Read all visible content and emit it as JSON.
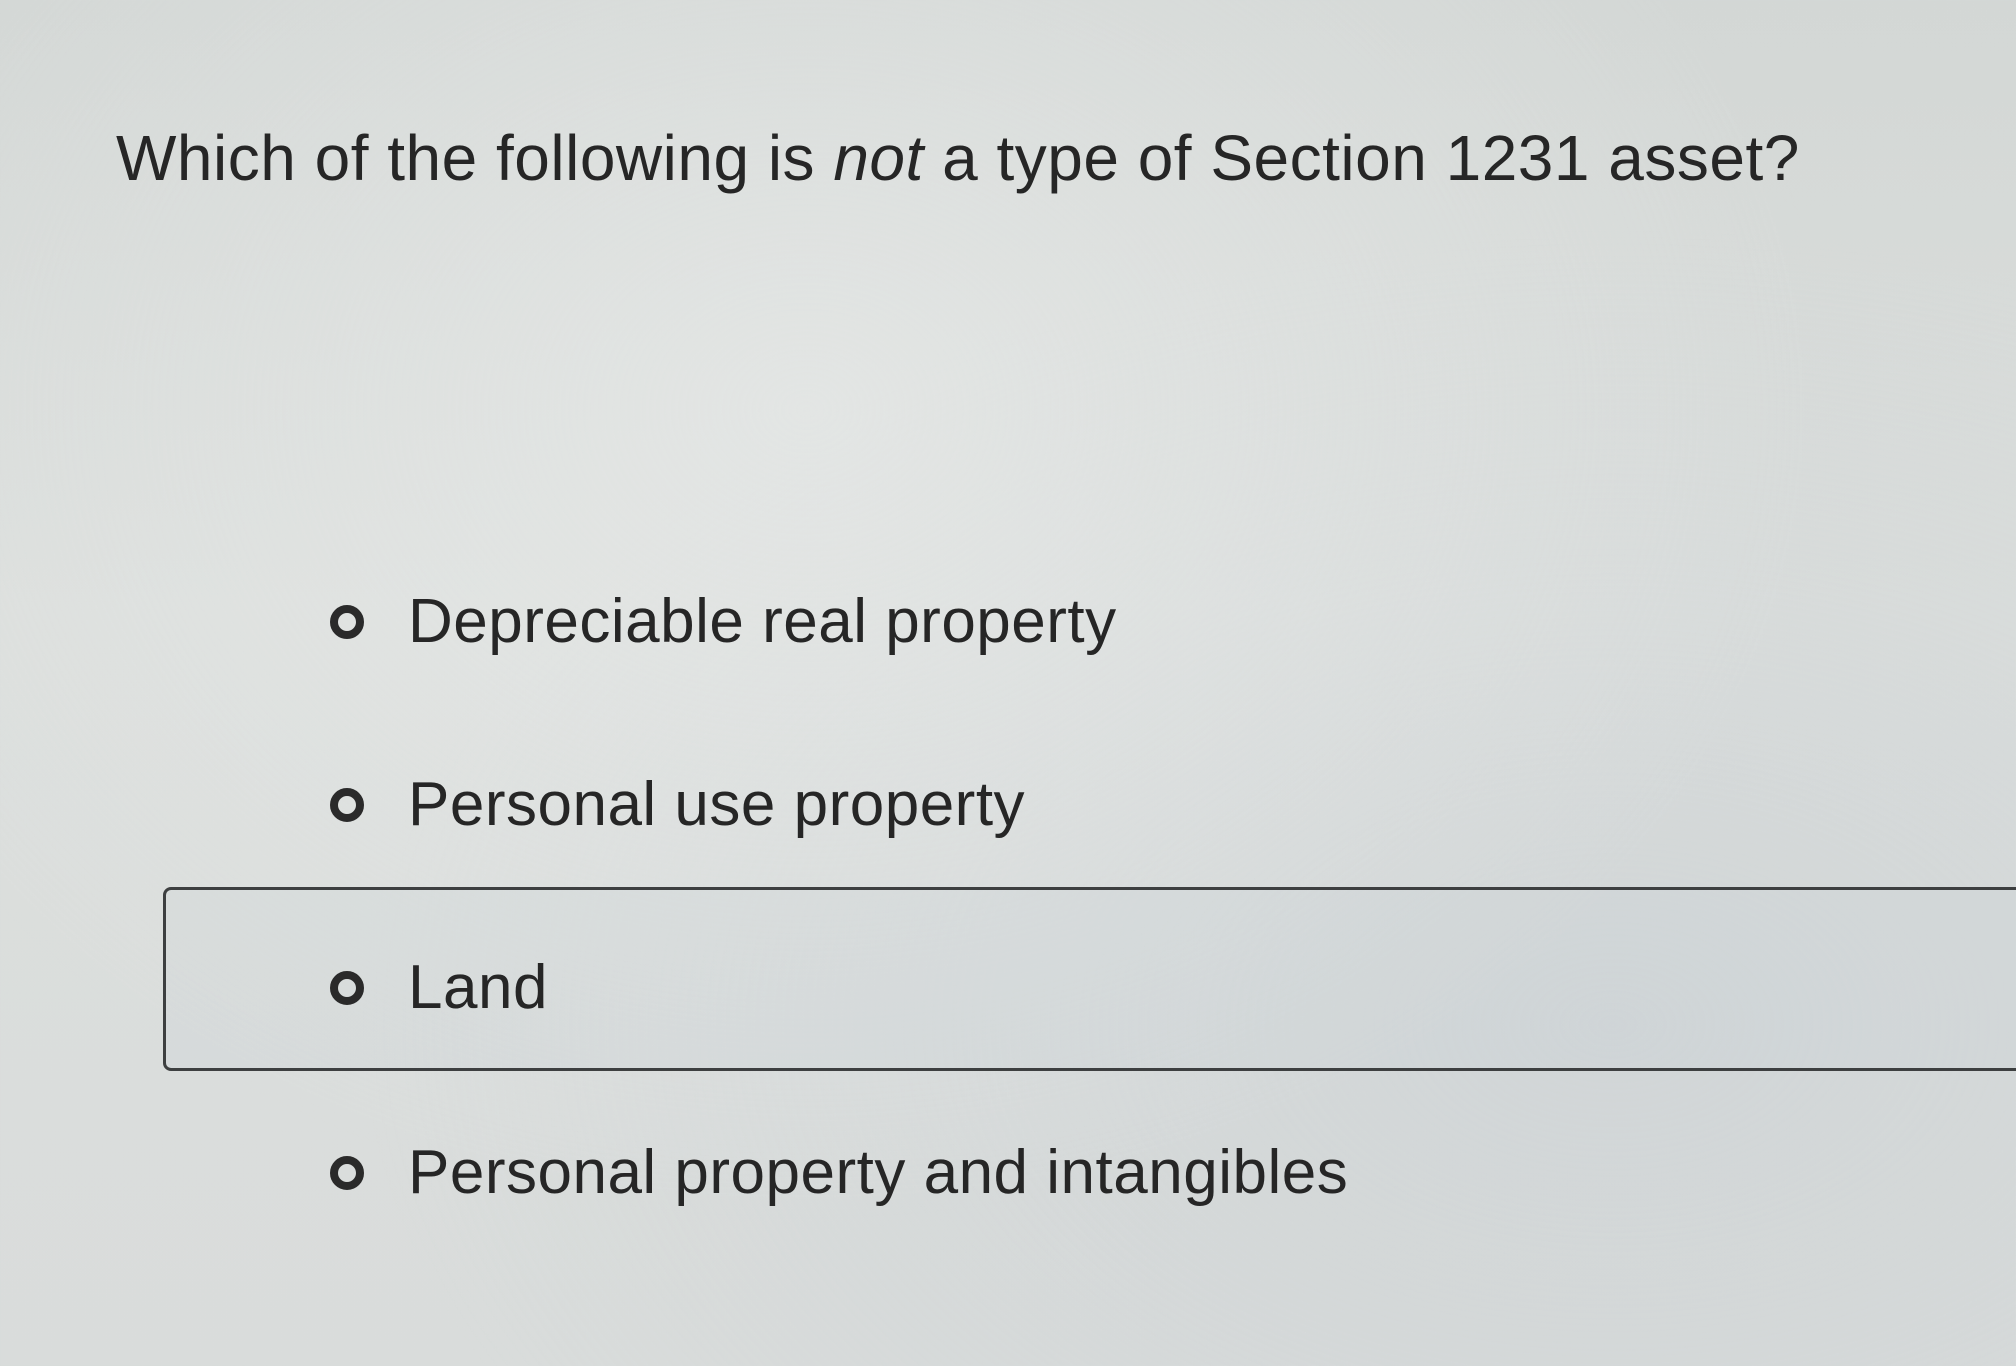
{
  "question": {
    "text_before": "Which of the following is ",
    "emphasis": "not",
    "text_after": " a type of Section 1231 asset?"
  },
  "options": [
    {
      "label": "Depreciable real property",
      "selected": false
    },
    {
      "label": "Personal use property",
      "selected": false
    },
    {
      "label": "Land",
      "selected": false,
      "focused": true
    },
    {
      "label": "Personal property and intangibles",
      "selected": false
    }
  ]
}
